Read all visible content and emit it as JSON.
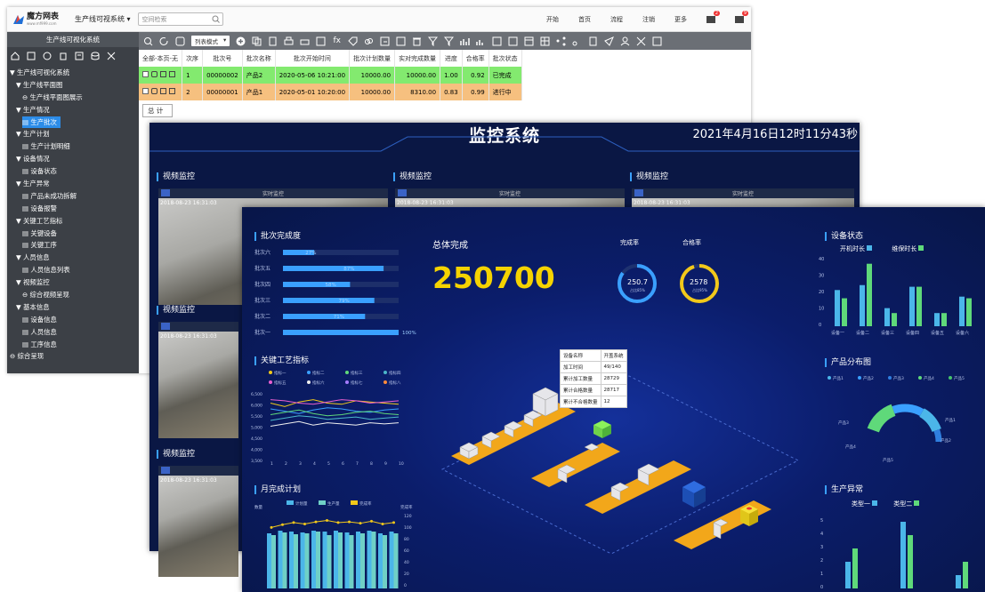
{
  "erp": {
    "logo_text": "魔方网表",
    "logo_sub": "www.mf999.com",
    "system_select": "生产线可视系统",
    "search_placeholder": "空间检索",
    "menus": [
      "开始",
      "首页",
      "流程",
      "注销",
      "更多"
    ],
    "badges": [
      "2",
      "9"
    ],
    "sidebar_title": "生产线可视化系统",
    "tree": [
      {
        "level": 0,
        "text": "▼ 生产线可视化系统"
      },
      {
        "level": 1,
        "text": "▼ 生产线平面图"
      },
      {
        "level": 2,
        "text": "⊖ 生产线平面图展示"
      },
      {
        "level": 1,
        "text": "▼ 生产情况"
      },
      {
        "level": 2,
        "text": "▤ 生产批次",
        "selected": true
      },
      {
        "level": 1,
        "text": "▼ 生产计划"
      },
      {
        "level": 2,
        "text": "▤ 生产计划明细"
      },
      {
        "level": 1,
        "text": "▼ 设备情况"
      },
      {
        "level": 2,
        "text": "▤ 设备状态"
      },
      {
        "level": 1,
        "text": "▼ 生产异常"
      },
      {
        "level": 2,
        "text": "▤ 产品未成功拆解"
      },
      {
        "level": 2,
        "text": "▤ 设备报警"
      },
      {
        "level": 1,
        "text": "▼ 关键工艺指标"
      },
      {
        "level": 2,
        "text": "▤ 关键设备"
      },
      {
        "level": 2,
        "text": "▤ 关键工序"
      },
      {
        "level": 1,
        "text": "▼ 人员信息"
      },
      {
        "level": 2,
        "text": "▤ 人员信息列表"
      },
      {
        "level": 1,
        "text": "▼ 视频监控"
      },
      {
        "level": 2,
        "text": "⊖ 综合视频呈现"
      },
      {
        "level": 1,
        "text": "▼ 基本信息"
      },
      {
        "level": 2,
        "text": "▤ 设备信息"
      },
      {
        "level": 2,
        "text": "▤ 人员信息"
      },
      {
        "level": 2,
        "text": "▤ 工序信息"
      },
      {
        "level": 0,
        "text": "⊖ 综合呈现"
      }
    ],
    "view_mode": "列表模式",
    "columns": [
      "全部-本页-无",
      "次序",
      "批次号",
      "批次名称",
      "批次开始时间",
      "批次计划数量",
      "实对完成数量",
      "进度",
      "合格率",
      "批次状态"
    ],
    "rows": [
      [
        "",
        "1",
        "00000002",
        "产品2",
        "2020-05-06 10:21:00",
        "10000.00",
        "10000.00",
        "1.00",
        "0.92",
        "已完成"
      ],
      [
        "",
        "2",
        "00000001",
        "产品1",
        "2020-05-01 10:20:00",
        "10000.00",
        "8310.00",
        "0.83",
        "0.99",
        "进行中"
      ]
    ],
    "total_label": "总 计"
  },
  "monitor": {
    "title": "监控系统",
    "datetime": "2021年4月16日12时11分43秒",
    "video_label": "视频监控",
    "live_label": "实时监控",
    "video_timestamp": "2018-08-23 16:31:03"
  },
  "dashboard": {
    "batch_title": "批次完成度",
    "batches": [
      {
        "name": "批次六",
        "pct": 27,
        "label": "27%"
      },
      {
        "name": "批次五",
        "pct": 87,
        "label": "87%"
      },
      {
        "name": "批次四",
        "pct": 58,
        "label": "58%"
      },
      {
        "name": "批次三",
        "pct": 79,
        "label": "79%"
      },
      {
        "name": "批次二",
        "pct": 71,
        "label": "71%"
      },
      {
        "name": "批次一",
        "pct": 100,
        "label": "100%"
      }
    ],
    "kpi_title": "关键工艺指标",
    "kpi_legend": [
      "指标一",
      "指标二",
      "指标三",
      "指标四",
      "指标五",
      "指标六",
      "指标七",
      "指标八"
    ],
    "kpi_yticks": [
      "6,500",
      "6,000",
      "5,500",
      "5,000",
      "4,500",
      "4,000",
      "3,500"
    ],
    "kpi_xticks": [
      "1",
      "2",
      "3",
      "4",
      "5",
      "6",
      "7",
      "8",
      "9",
      "10"
    ],
    "monthly_title": "月完成计划",
    "monthly_legend": [
      "计划量",
      "生产量",
      "完成率"
    ],
    "monthly_left_unit": "数量",
    "monthly_right_unit": "完成率",
    "monthly_right_ticks": [
      "120",
      "100",
      "80",
      "60",
      "40",
      "20",
      "0"
    ],
    "total_title": "总体完成",
    "total_value": "250700",
    "ring1": {
      "title": "完成率",
      "value": "250.7",
      "sub": "占比85%",
      "pct": 85,
      "color": "#3aa0ff"
    },
    "ring2": {
      "title": "合格率",
      "value": "2578",
      "sub": "占比95%",
      "pct": 95,
      "color": "#f2c81a"
    },
    "info_table": [
      [
        "设备名称",
        "开盖系统"
      ],
      [
        "加工时间",
        "49/140"
      ],
      [
        "累计加工数量",
        "28729"
      ],
      [
        "累计合格数量",
        "28717"
      ],
      [
        "累计不合格数量",
        "12"
      ]
    ],
    "equip_title": "设备状态",
    "equip_legend": [
      "开机时长",
      "维保时长"
    ],
    "equip_yticks": [
      "40",
      "30",
      "20",
      "10",
      "0"
    ],
    "equip_names": [
      "设备一",
      "设备二",
      "设备三",
      "设备四",
      "设备五",
      "设备六"
    ],
    "product_title": "产品分布图",
    "product_legend": [
      "产品1",
      "产品2",
      "产品3",
      "产品4",
      "产品5"
    ],
    "product_labels": [
      "产品1",
      "产品2",
      "产品3",
      "产品4",
      "产品5"
    ],
    "anomaly_title": "生产异常",
    "anomaly_legend": [
      "类型一",
      "类型二"
    ],
    "anomaly_yticks": [
      "5",
      "4",
      "3",
      "2",
      "1",
      "0"
    ],
    "colors": {
      "green": "#5fd97a",
      "blue": "#3aa0ff",
      "yellow": "#f2c81a",
      "teal": "#4bb6c9"
    }
  },
  "chart_data": [
    {
      "type": "bar",
      "title": "批次完成度",
      "categories": [
        "批次六",
        "批次五",
        "批次四",
        "批次三",
        "批次二",
        "批次一"
      ],
      "values": [
        27,
        87,
        58,
        79,
        71,
        100
      ]
    },
    {
      "type": "bar",
      "title": "设备状态",
      "categories": [
        "设备一",
        "设备二",
        "设备三",
        "设备四",
        "设备五",
        "设备六"
      ],
      "series": [
        {
          "name": "开机时长",
          "values": [
            22,
            25,
            11,
            24,
            8,
            18
          ]
        },
        {
          "name": "维保时长",
          "values": [
            17,
            38,
            8,
            24,
            8,
            17
          ]
        }
      ],
      "ylim": [
        0,
        40
      ]
    },
    {
      "type": "bar",
      "title": "生产异常",
      "series": [
        {
          "name": "类型一",
          "values": [
            2,
            5,
            1
          ]
        },
        {
          "name": "类型二",
          "values": [
            3,
            4,
            2
          ]
        }
      ],
      "ylim": [
        0,
        5
      ]
    },
    {
      "type": "bar",
      "title": "月完成计划",
      "series": [
        {
          "name": "计划量",
          "values": [
            62,
            65,
            64,
            63,
            65,
            64,
            65,
            63,
            64,
            65,
            62,
            64
          ]
        },
        {
          "name": "生产量",
          "values": [
            60,
            63,
            61,
            62,
            64,
            60,
            63,
            60,
            62,
            64,
            60,
            62
          ]
        },
        {
          "name": "完成率",
          "values": [
            88,
            92,
            95,
            93,
            96,
            98,
            95,
            96,
            94,
            97,
            93,
            95
          ]
        }
      ],
      "y2lim": [
        0,
        120
      ]
    }
  ]
}
